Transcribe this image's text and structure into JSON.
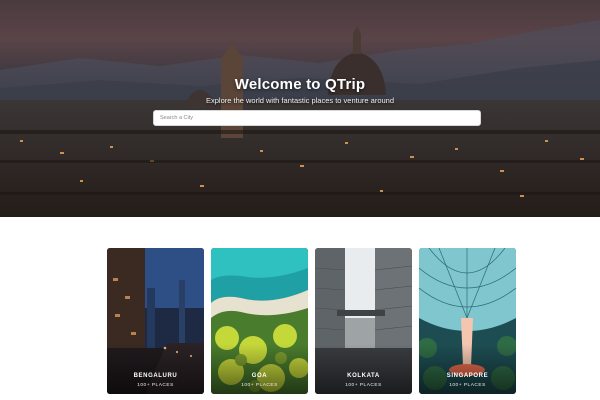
{
  "hero": {
    "title": "Welcome to QTrip",
    "subtitle": "Explore the world with fantastic places to venture around",
    "search": {
      "placeholder": "Search a City"
    }
  },
  "cities": [
    {
      "name": "BENGALURU",
      "places": "100+ PLACES",
      "theme": "night-street",
      "accent": "#2f5fa8"
    },
    {
      "name": "GOA",
      "places": "100+ PLACES",
      "theme": "aerial-beach",
      "accent": "#2aa9a4"
    },
    {
      "name": "KOLKATA",
      "places": "100+ PLACES",
      "theme": "grey-buildings",
      "accent": "#8a8f94"
    },
    {
      "name": "SINGAPORE",
      "places": "100+ PLACES",
      "theme": "rain-vortex",
      "accent": "#e0734f"
    }
  ]
}
